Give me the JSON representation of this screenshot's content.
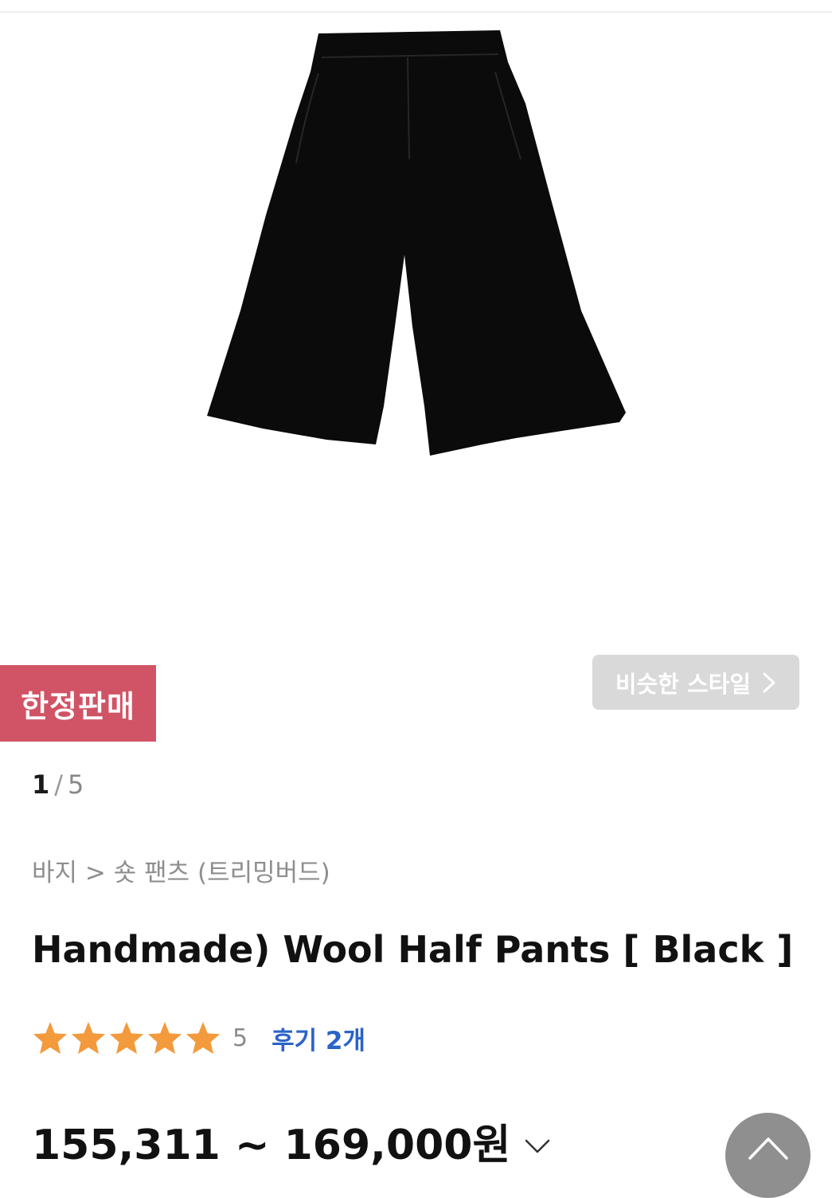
{
  "colors": {
    "limited_badge_bg": "#d05465",
    "similar_button_bg": "#d9d9d9",
    "review_link": "#2a63c9",
    "star": "#f39a3c",
    "scroll_top_bg": "#8f8f8f"
  },
  "product": {
    "image_icon": "black-wool-half-pants-photo",
    "limited_badge": "한정판매",
    "similar_style_label": "비슷한 스타일",
    "similar_style_icon": "chevron-right-icon",
    "pager": {
      "current": "1",
      "separator": "/",
      "total": "5"
    },
    "breadcrumb": "바지 > 숏 팬츠 (트리밍버드)",
    "title": "Handmade) Wool Half Pants [ Black ]",
    "rating": {
      "stars": 5,
      "score": "5",
      "reviews_label": "후기 2개"
    },
    "price": "155,311 ~ 169,000원",
    "price_toggle_icon": "chevron-down-icon"
  },
  "scroll_top_icon": "chevron-up-icon"
}
